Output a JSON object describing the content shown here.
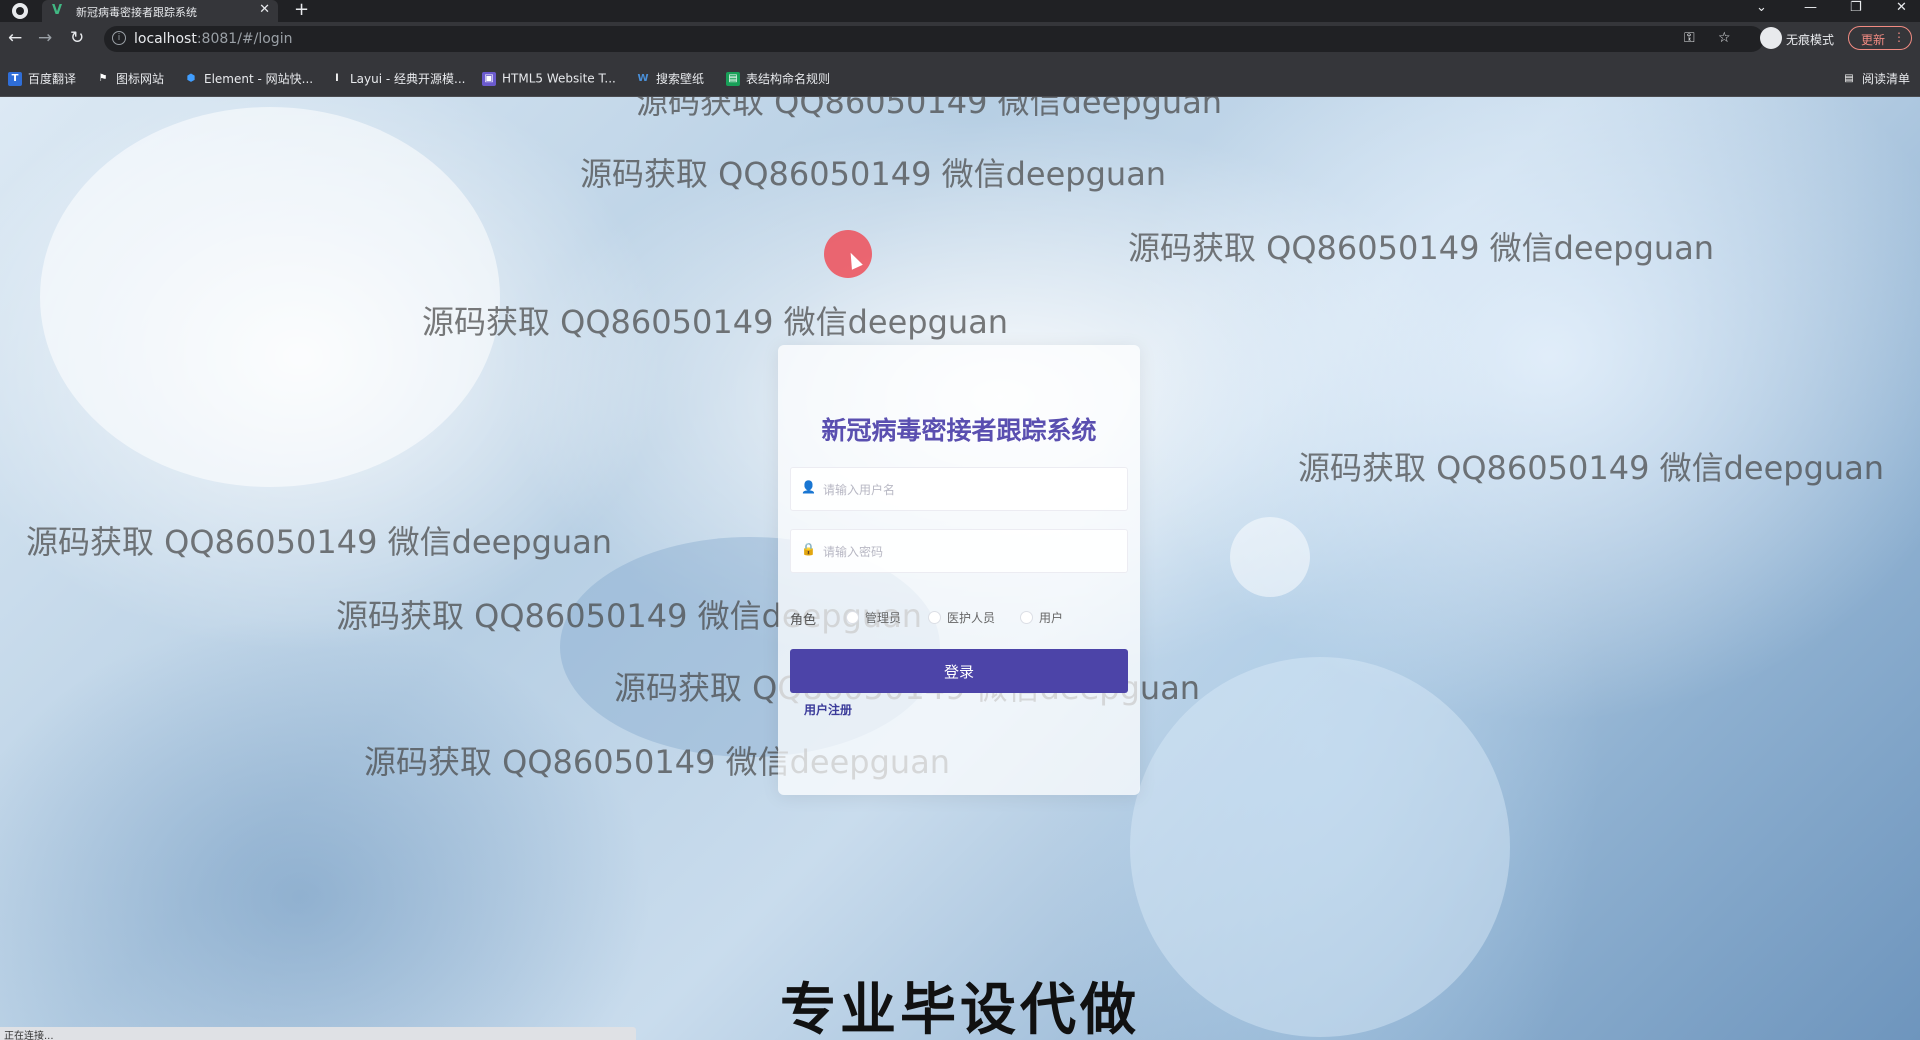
{
  "browser": {
    "tab_title": "新冠病毒密接者跟踪系统",
    "tab_favicon": "V",
    "url_host": "localhost",
    "url_path": ":8081/#/login",
    "incognito_label": "无痕模式",
    "update_label": "更新",
    "reading_list_label": "阅读清单",
    "bookmarks": [
      {
        "label": "百度翻译",
        "icon": "T",
        "color": "#2f6ed8"
      },
      {
        "label": "图标网站",
        "icon": "⚑",
        "color": "#1c1c1c"
      },
      {
        "label": "Element - 网站快...",
        "icon": "⬢",
        "color": "#409eff"
      },
      {
        "label": "Layui - 经典开源模...",
        "icon": "l",
        "color": "#2a2a2a"
      },
      {
        "label": "HTML5 Website T...",
        "icon": "▣",
        "color": "#6a5acd"
      },
      {
        "label": "搜索壁纸",
        "icon": "W",
        "color": "#4a90d9"
      },
      {
        "label": "表结构命名规则",
        "icon": "▤",
        "color": "#18a058"
      }
    ]
  },
  "watermark_text": "源码获取 QQ86050149 微信deepguan",
  "login": {
    "title": "新冠病毒密接者跟踪系统",
    "username_placeholder": "请输入用户名",
    "password_placeholder": "请输入密码",
    "role_label": "角色",
    "roles": [
      "管理员",
      "医护人员",
      "用户"
    ],
    "submit_label": "登录",
    "register_label": "用户注册"
  },
  "caption": "专业毕设代做",
  "status_text": "正在连接..."
}
